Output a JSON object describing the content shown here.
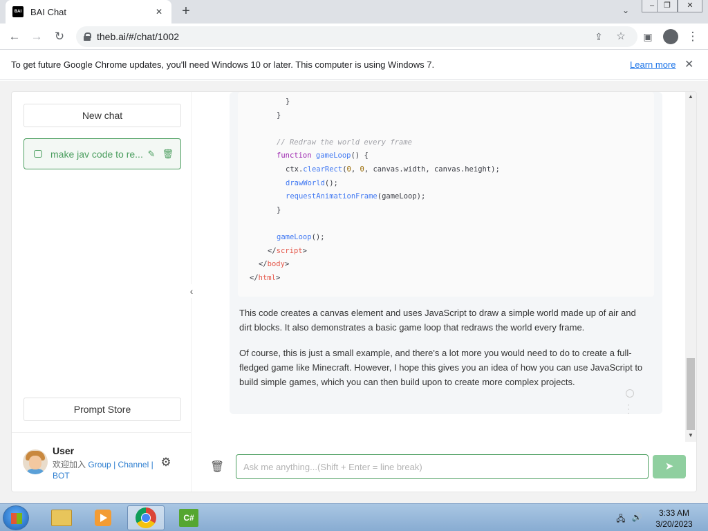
{
  "browser": {
    "tab_title": "BAI Chat",
    "tab_favicon_text": "BAI",
    "url": "theb.ai/#/chat/1002",
    "icons": [
      "close-icon",
      "plus-icon",
      "chevron-down-icon",
      "back-icon",
      "forward-icon",
      "reload-icon",
      "lock-icon",
      "share-icon",
      "star-icon",
      "sidepanel-icon",
      "profile-icon",
      "kebab-icon"
    ]
  },
  "infobar": {
    "message": "To get future Google Chrome updates, you'll need Windows 10 or later. This computer is using Windows 7.",
    "learn_more": "Learn more"
  },
  "sidebar": {
    "new_chat": "New chat",
    "history": [
      {
        "label": "make jav code to re..."
      }
    ],
    "prompt_store": "Prompt Store",
    "user": {
      "name": "User",
      "join_text": "欢迎加入",
      "links": [
        "Group",
        "Channel",
        "BOT"
      ],
      "separator": "|"
    }
  },
  "chat": {
    "code_lines": [
      {
        "indent": 5,
        "parts": [
          [
            "tx",
            "}"
          ]
        ]
      },
      {
        "indent": 4,
        "parts": [
          [
            "tx",
            "}"
          ]
        ]
      },
      {
        "indent": 0,
        "parts": []
      },
      {
        "indent": 4,
        "parts": [
          [
            "cm",
            "// Redraw the world every frame"
          ]
        ]
      },
      {
        "indent": 4,
        "parts": [
          [
            "kw",
            "function "
          ],
          [
            "fn",
            "gameLoop"
          ],
          [
            "tx",
            "() {"
          ]
        ]
      },
      {
        "indent": 5,
        "parts": [
          [
            "tx",
            "ctx."
          ],
          [
            "fn",
            "clearRect"
          ],
          [
            "tx",
            "("
          ],
          [
            "nm",
            "0"
          ],
          [
            "tx",
            ", "
          ],
          [
            "nm",
            "0"
          ],
          [
            "tx",
            ", canvas.width, canvas.height);"
          ]
        ]
      },
      {
        "indent": 5,
        "parts": [
          [
            "fn",
            "drawWorld"
          ],
          [
            "tx",
            "();"
          ]
        ]
      },
      {
        "indent": 5,
        "parts": [
          [
            "fn",
            "requestAnimationFrame"
          ],
          [
            "tx",
            "(gameLoop);"
          ]
        ]
      },
      {
        "indent": 4,
        "parts": [
          [
            "tx",
            "}"
          ]
        ]
      },
      {
        "indent": 0,
        "parts": []
      },
      {
        "indent": 4,
        "parts": [
          [
            "fn",
            "gameLoop"
          ],
          [
            "tx",
            "();"
          ]
        ]
      },
      {
        "indent": 3,
        "parts": [
          [
            "tx",
            "</"
          ],
          [
            "tg",
            "script"
          ],
          [
            "tx",
            ">"
          ]
        ]
      },
      {
        "indent": 2,
        "parts": [
          [
            "tx",
            "</"
          ],
          [
            "tg",
            "body"
          ],
          [
            "tx",
            ">"
          ]
        ]
      },
      {
        "indent": 1,
        "parts": [
          [
            "tx",
            "</"
          ],
          [
            "tg",
            "html"
          ],
          [
            "tx",
            ">"
          ]
        ]
      }
    ],
    "paragraph1": "This code creates a canvas element and uses JavaScript to draw a simple world made up of air and dirt blocks. It also demonstrates a basic game loop that redraws the world every frame.",
    "paragraph2": "Of course, this is just a small example, and there's a lot more you would need to do to create a full-fledged game like Minecraft. However, I hope this gives you an idea of how you can use JavaScript to build simple games, which you can then build upon to create more complex projects.",
    "input_placeholder": "Ask me anything...(Shift + Enter = line break)",
    "input_value": ""
  },
  "taskbar": {
    "apps": [
      "file-explorer",
      "media-player",
      "chrome",
      "csharp-app"
    ],
    "active_app": "chrome",
    "time": "3:33 AM",
    "date": "3/20/2023"
  },
  "colors": {
    "accent": "#4b9e5f",
    "send_button": "#8fcf9f",
    "link": "#1a73e8"
  }
}
